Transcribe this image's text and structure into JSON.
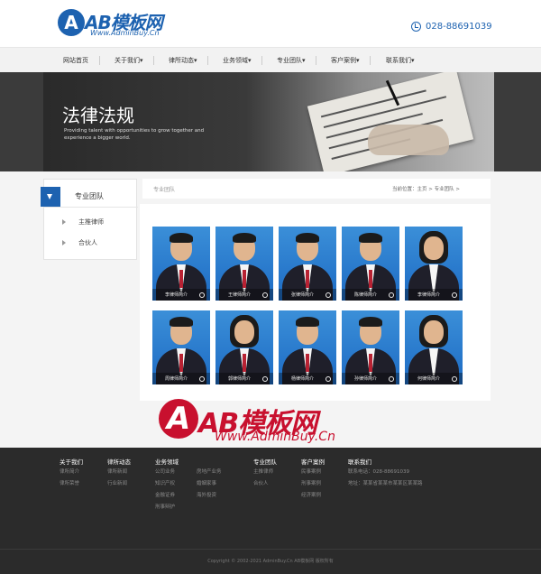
{
  "header": {
    "logo_text": "AB模板网",
    "logo_sub": "Www.AdminBuy.Cn",
    "phone": "028-88691039"
  },
  "nav": {
    "items": [
      "网站首页",
      "关于我们▾",
      "律所动态▾",
      "业务领域▾",
      "专业团队▾",
      "客户案例▾",
      "联系我们▾"
    ]
  },
  "banner": {
    "title": "法律法规",
    "subtitle": "Providing talent with opportunities to grow together and experience a bigger world."
  },
  "sidebar": {
    "title": "专业团队",
    "items": [
      "主推律师",
      "合伙人"
    ]
  },
  "main": {
    "section_title": "专业团队",
    "breadcrumb": "当前位置：主页 > 专业团队 >"
  },
  "team": [
    {
      "name": "李律师简介"
    },
    {
      "name": "王律师简介"
    },
    {
      "name": "张律师简介"
    },
    {
      "name": "陈律师简介"
    },
    {
      "name": "李律师简介"
    },
    {
      "name": "周律师简介"
    },
    {
      "name": "郭律师简介"
    },
    {
      "name": "杨律师简介"
    },
    {
      "name": "孙律师简介"
    },
    {
      "name": "何律师简介"
    }
  ],
  "watermark": {
    "text": "AB模板网",
    "sub": "Www.AdminBuy.Cn"
  },
  "footer": {
    "columns": [
      {
        "head": "关于我们",
        "links": [
          "律所简介",
          "律所荣誉"
        ]
      },
      {
        "head": "律所动态",
        "links": [
          "律所新闻",
          "行业新闻"
        ]
      },
      {
        "head": "业务领域",
        "links": [
          "公司业务",
          "知识产权",
          "金融证券",
          "刑事辩护"
        ]
      },
      {
        "head": "",
        "links": [
          "房地产业务",
          "婚姻家事",
          "海外投资"
        ]
      },
      {
        "head": "专业团队",
        "links": [
          "主推律师",
          "合伙人"
        ]
      },
      {
        "head": "客户案例",
        "links": [
          "民事案例",
          "刑事案例",
          "经济案例"
        ]
      },
      {
        "head": "联系我们",
        "links": [
          "联系电话：028-88691039",
          "地址：某某省某某市某某区某某路"
        ]
      }
    ],
    "copyright": "Copyright © 2002-2021 AdminBuy.Cn AB模板网 版权所有"
  }
}
